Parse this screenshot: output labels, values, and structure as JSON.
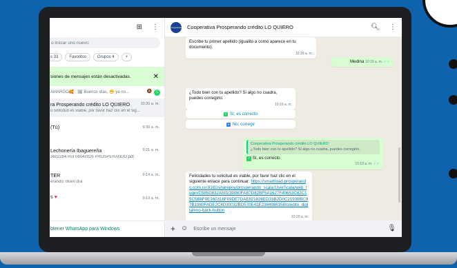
{
  "left": {
    "search_placeholder": "o iniciar uno nuevo",
    "chips": [
      "s 33",
      "Favoritos",
      "Grupos 4"
    ],
    "add_chip": "+",
    "banner_text": "siones de mensajes están desactivadas.",
    "partial_chat_line": "AMARGO🥰 : 🖼 Buenos días, 😁 ya no...",
    "partial_badge": "1",
    "chats": [
      {
        "name": "ra Prosperando crédito LO QUIERO",
        "time": "10:20 a. m.",
        "snippet": "u solicitud es viable, por favor haz clic en el sig..."
      },
      {
        "name": "(Tú)",
        "time": "9:30 a. m.",
        "snippet": ""
      },
      {
        "name": "Lechonería Ibaguereña",
        "time": "9:21 a. m.",
        "snippet": "3602294 Rut 06042026 PROSPERANDO.pdf"
      },
      {
        "name": "TER",
        "time": "9:14 a. m.",
        "snippet": "erando: Buen día"
      },
      {
        "name": "s",
        "time": "9:13 a. m.",
        "snippet": ""
      }
    ],
    "get_whatsapp": "btener WhatsApp para Windows"
  },
  "chat": {
    "title": "Cooperativa Prosperando crédito LO QUIERO",
    "avatar_text": "Prosperando",
    "composer_placeholder": "Escribe un mensaje",
    "messages": {
      "m1": {
        "text": "Escribe tu primer apellido (igualito a como aparece en tu documento).",
        "time": "10:18 a. m."
      },
      "m2": {
        "text": "Medina",
        "time": "10:19 a. m."
      },
      "m3": {
        "text": "¿Todo bien con tu apellido? Si algo no cuadra, puedes corregirlo.",
        "time": "10:19 a. m."
      },
      "btn1": "Sí, es correcto",
      "btn2": "No, corregir",
      "m4": {
        "quote_name": "Cooperativa Prosperando crédito LO QUIERO",
        "quote_text": "¿Todo bien con tu apellido? Si algo no cuadra, puedes corregirlo.",
        "text": "Sí, es correcto",
        "time": "10:19 a. m."
      },
      "m5": {
        "text": "Felicidades tu solicitud es viable, por favor haz clic en el siguiente enlace para continuar:",
        "link": "https://smartroad.prosperando.com.co:8181/sharepoy/prosperando_scala.UserScala/web_login/C585D832A50239880FAB7D82BF5A1627F40653C82C15C5B8F0E160316F09DE7DAE821826ED33B2D0C2193BBC97B1980FADE2C4D30032BD570E42E2384986358/credito_digital#no-back-button",
        "time": "10:20 a. m."
      }
    }
  }
}
